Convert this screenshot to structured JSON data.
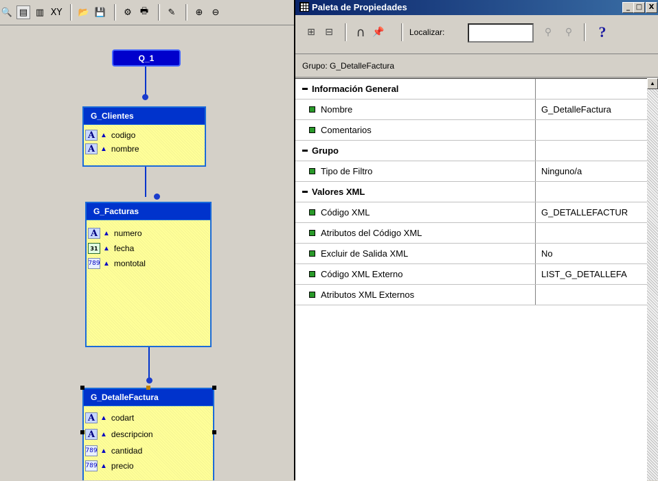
{
  "editor": {
    "query": "Q_1",
    "groups": [
      {
        "name": "G_Clientes",
        "fields": [
          {
            "type": "char",
            "label": "codigo"
          },
          {
            "type": "char",
            "label": "nombre"
          }
        ]
      },
      {
        "name": "G_Facturas",
        "fields": [
          {
            "type": "char",
            "label": "numero"
          },
          {
            "type": "date",
            "label": "fecha"
          },
          {
            "type": "number",
            "label": "montotal"
          }
        ]
      },
      {
        "name": "G_DetalleFactura",
        "fields": [
          {
            "type": "char",
            "label": "codart"
          },
          {
            "type": "char",
            "label": "descripcion"
          },
          {
            "type": "number",
            "label": "cantidad"
          },
          {
            "type": "number",
            "label": "precio"
          }
        ]
      }
    ],
    "icon_text": {
      "char": "A",
      "number": "789",
      "date": "31"
    }
  },
  "palette": {
    "title": "Paleta de Propiedades",
    "find_label": "Localizar:",
    "find_value": "",
    "group_line": "Grupo: G_DetalleFactura",
    "help_glyph": "?",
    "window_buttons": [
      "_",
      "□",
      "X"
    ],
    "rows": [
      {
        "kind": "category",
        "name": "Información General",
        "value": ""
      },
      {
        "kind": "prop",
        "name": "Nombre",
        "value": "G_DetalleFactura"
      },
      {
        "kind": "prop",
        "name": "Comentarios",
        "value": ""
      },
      {
        "kind": "category",
        "name": "Grupo",
        "value": ""
      },
      {
        "kind": "prop",
        "name": "Tipo de Filtro",
        "value": "Ninguno/a"
      },
      {
        "kind": "category",
        "name": "Valores XML",
        "value": ""
      },
      {
        "kind": "prop",
        "name": "Código XML",
        "value": "G_DETALLEFACTUR"
      },
      {
        "kind": "prop",
        "name": "Atributos del Código XML",
        "value": ""
      },
      {
        "kind": "prop",
        "name": "Excluir de Salida XML",
        "value": "No"
      },
      {
        "kind": "prop",
        "name": "Código XML Externo",
        "value": "LIST_G_DETALLEFA"
      },
      {
        "kind": "prop",
        "name": "Atributos XML Externos",
        "value": ""
      }
    ]
  },
  "colors": {
    "group_header": "#0033cc",
    "group_body": "#ffff99",
    "title_bar": "#0a246a"
  }
}
